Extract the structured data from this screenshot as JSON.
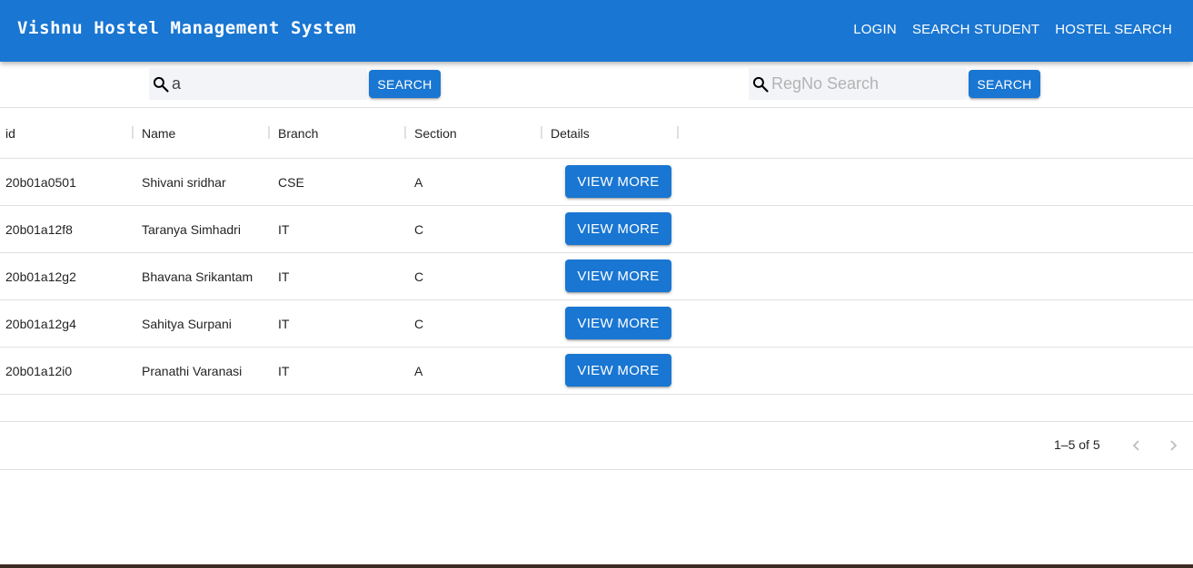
{
  "appbar": {
    "title": "Vishnu Hostel Management System",
    "nav": [
      "LOGIN",
      "SEARCH STUDENT",
      "HOSTEL SEARCH"
    ]
  },
  "search_name": {
    "value": "a",
    "placeholder": "",
    "button": "SEARCH"
  },
  "search_regno": {
    "value": "",
    "placeholder": "RegNo Search",
    "button": "SEARCH"
  },
  "table": {
    "columns": [
      "id",
      "Name",
      "Branch",
      "Section",
      "Details"
    ],
    "rows": [
      {
        "id": "20b01a0501",
        "name": "Shivani sridhar",
        "branch": "CSE",
        "section": "A",
        "action": "VIEW MORE"
      },
      {
        "id": "20b01a12f8",
        "name": "Taranya Simhadri",
        "branch": "IT",
        "section": "C",
        "action": "VIEW MORE"
      },
      {
        "id": "20b01a12g2",
        "name": "Bhavana Srikantam",
        "branch": "IT",
        "section": "C",
        "action": "VIEW MORE"
      },
      {
        "id": "20b01a12g4",
        "name": "Sahitya Surpani",
        "branch": "IT",
        "section": "C",
        "action": "VIEW MORE"
      },
      {
        "id": "20b01a12i0",
        "name": "Pranathi Varanasi",
        "branch": "IT",
        "section": "A",
        "action": "VIEW MORE"
      }
    ]
  },
  "pagination": {
    "info": "1–5 of 5"
  },
  "colors": {
    "primary": "#1976d2",
    "search_bg": "#f3f4f8",
    "divider": "#e0e0e0"
  },
  "icons": [
    "search-icon",
    "chevron-left-icon",
    "chevron-right-icon"
  ]
}
